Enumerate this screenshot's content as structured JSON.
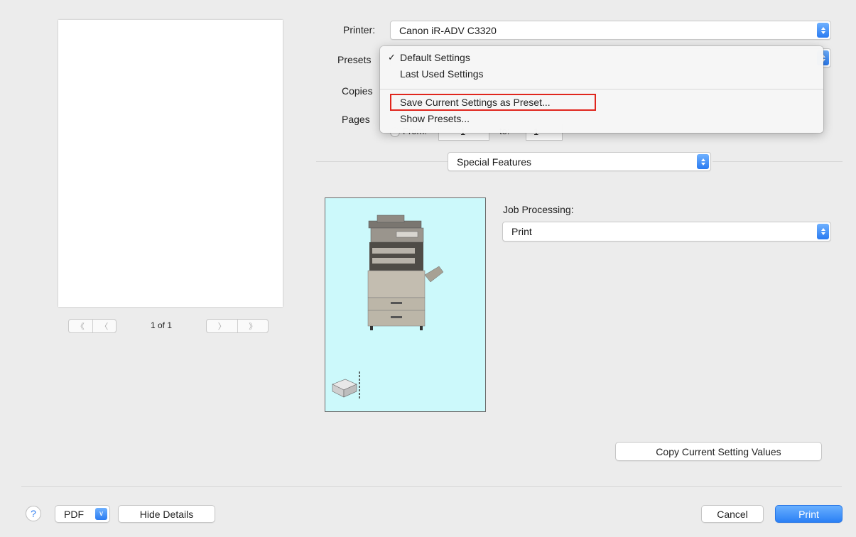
{
  "preview": {
    "page_count": "1 of 1",
    "first_icon": "double-chevron-left-icon",
    "prev_icon": "chevron-left-icon",
    "next_icon": "chevron-right-icon",
    "last_icon": "double-chevron-right-icon"
  },
  "printer": {
    "label": "Printer:",
    "value": "Canon iR-ADV C3320"
  },
  "presets": {
    "label": "Presets"
  },
  "copies": {
    "label": "Copies"
  },
  "pages": {
    "label": "Pages",
    "from_label": "From:",
    "from_value": "1",
    "to_label": "to:",
    "to_value": "1"
  },
  "presets_menu": {
    "items": [
      {
        "label": "Default Settings",
        "checked": true
      },
      {
        "label": "Last Used Settings",
        "checked": false
      },
      {
        "label": "Save Current Settings as Preset...",
        "checked": false,
        "highlighted": true
      },
      {
        "label": "Show Presets...",
        "checked": false
      }
    ]
  },
  "panel_select": {
    "value": "Special Features"
  },
  "job_processing": {
    "label": "Job Processing:",
    "value": "Print"
  },
  "copy_values_button": "Copy Current Setting Values",
  "footer": {
    "help": "?",
    "pdf": "PDF",
    "hide_details": "Hide Details",
    "cancel": "Cancel",
    "print": "Print"
  },
  "colors": {
    "accent": "#2b80f5",
    "image_bg": "#ccf9fb",
    "highlight_border": "#e0261d"
  }
}
